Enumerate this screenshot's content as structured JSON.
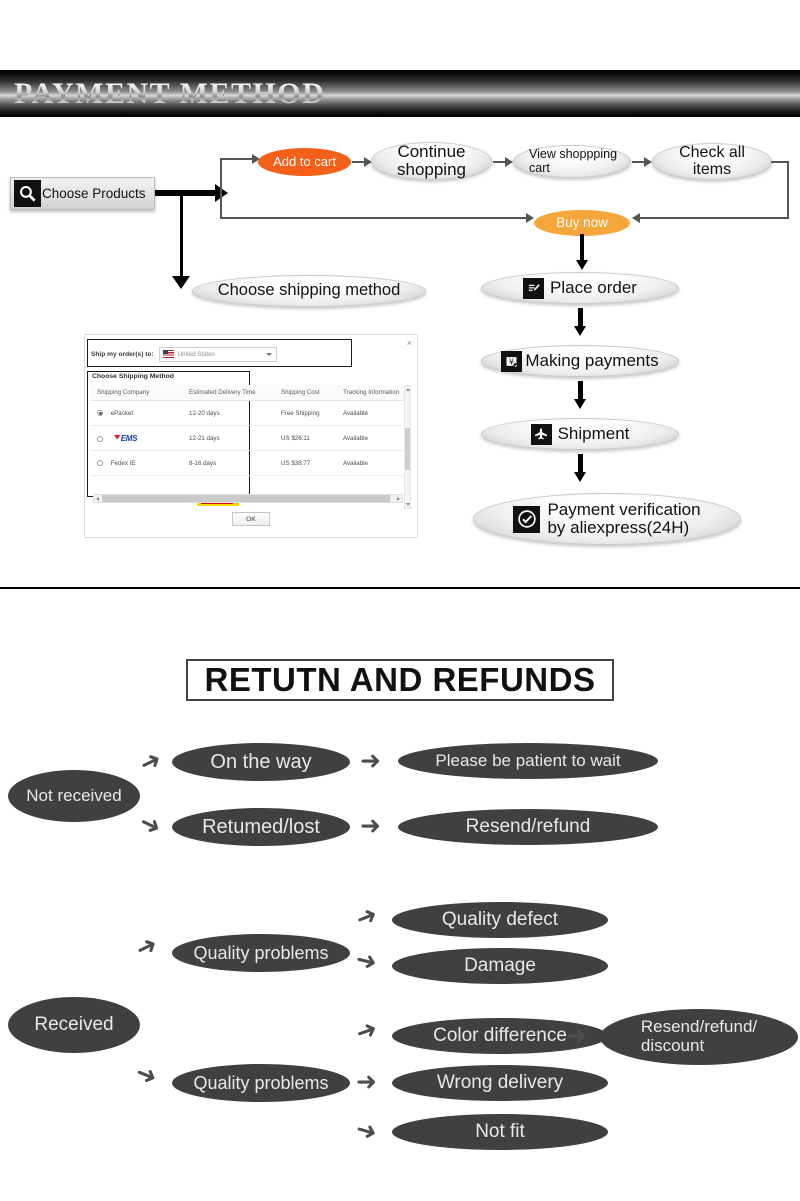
{
  "banner": {
    "title": "PAYMENT METHOD"
  },
  "payment_flow": {
    "start": {
      "label": "Choose Products",
      "icon": "magnifier-icon"
    },
    "cart_path": [
      {
        "id": "add-to-cart",
        "label": "Add to cart",
        "style": "orange-red"
      },
      {
        "id": "continue-shopping",
        "label": "Continue\nshopping",
        "style": "grey"
      },
      {
        "id": "view-cart",
        "label": "View shoppping\ncart",
        "style": "grey"
      },
      {
        "id": "check-all-items",
        "label": "Check  all\nitems",
        "style": "grey"
      }
    ],
    "buy_now": {
      "label": "Buy now",
      "style": "orange"
    },
    "shipping_branch": {
      "label": "Choose shipping method"
    },
    "steps": [
      {
        "id": "place-order",
        "label": "Place order",
        "icon": "order-form-icon"
      },
      {
        "id": "making-payments",
        "label": "Making payments",
        "icon": "yen-card-icon"
      },
      {
        "id": "shipment",
        "label": "Shipment",
        "icon": "airplane-icon"
      },
      {
        "id": "payment-verification",
        "label": "Payment verification\nby aliexpress(24H)",
        "icon": "check-circle-icon"
      }
    ]
  },
  "shipping_dialog": {
    "ship_to_label": "Ship my order(s) to:",
    "country_value": "United States",
    "section_title": "Choose Shipping Method",
    "columns": [
      "Shipping Company",
      "Estimated Delivery Time",
      "Shipping Cost",
      "Tracking Information"
    ],
    "rows": [
      {
        "selected": true,
        "company": "ePacket",
        "company_type": "text",
        "time": "12-20 days",
        "cost": "Free Shipping",
        "cost_free": true,
        "tracking": "Available"
      },
      {
        "selected": false,
        "company": "EMS",
        "company_type": "logo",
        "time": "12-21 days",
        "cost": "US $26.11",
        "cost_free": false,
        "tracking": "Available"
      },
      {
        "selected": false,
        "company": "Fedex IE",
        "company_type": "text",
        "time": "8-16 days",
        "cost": "US $38.77",
        "cost_free": false,
        "tracking": "Available"
      }
    ],
    "ok_label": "OK",
    "close_label": "×"
  },
  "returns": {
    "title": "RETUTN AND REFUNDS",
    "not_received": {
      "label": "Not received",
      "branches": [
        {
          "label": "On the way",
          "result": "Please be patient to wait"
        },
        {
          "label": "Retumed/lost",
          "result": "Resend/refund"
        }
      ]
    },
    "received": {
      "label": "Received",
      "groups": [
        {
          "label": "Quality problems",
          "results": [
            "Quality defect",
            "Damage"
          ]
        },
        {
          "label": "Quality problems",
          "results": [
            "Color difference",
            "Wrong delivery",
            "Not fit"
          ]
        }
      ],
      "final": "Resend/refund/\ndiscount"
    }
  },
  "colors": {
    "add_to_cart": "#f4601a",
    "buy_now": "#f5a63b",
    "dark_ellipse": "#404040",
    "cost_red": "#e8644a",
    "ems_blue": "#1540a0"
  }
}
